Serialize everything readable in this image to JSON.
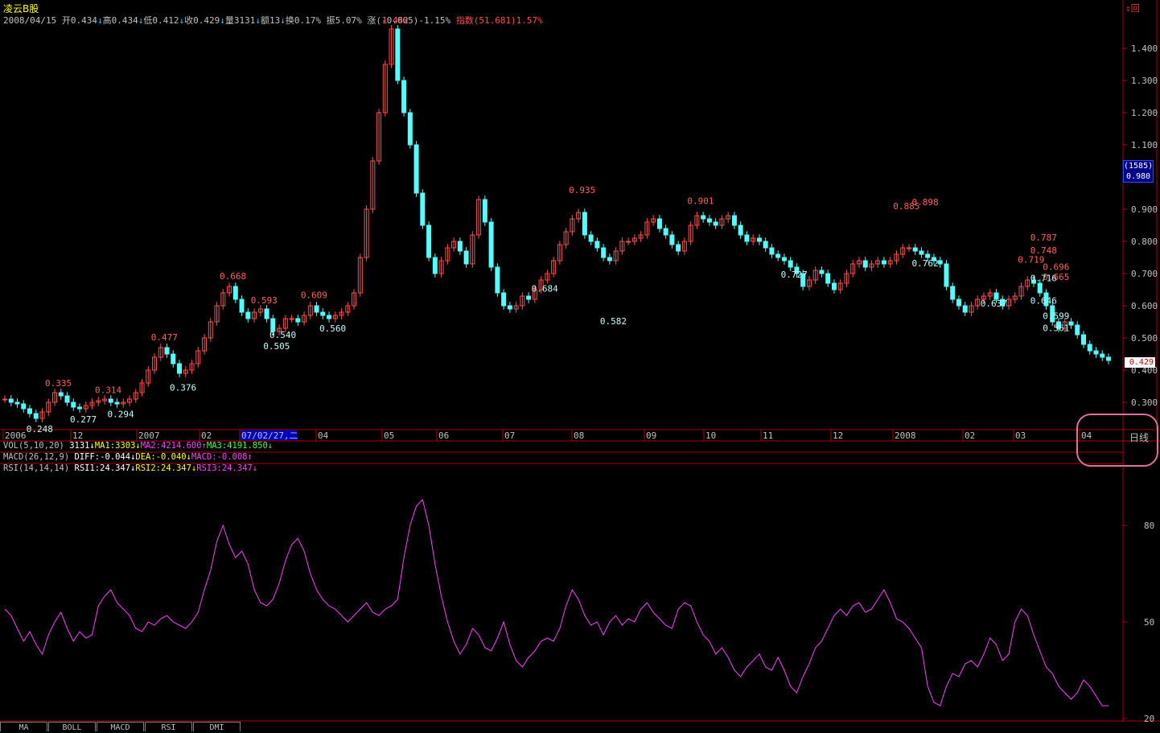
{
  "header": {
    "stock_name": "凌云B股",
    "info": [
      {
        "text": "2008/04/15",
        "color": "#c0c0c0"
      },
      {
        "text": " 开0.434",
        "color": "#c0c0c0"
      },
      {
        "text": "↓",
        "color": "#40c0ff"
      },
      {
        "text": "高0.434",
        "color": "#c0c0c0"
      },
      {
        "text": "↓",
        "color": "#40c0ff"
      },
      {
        "text": "低0.412",
        "color": "#c0c0c0"
      },
      {
        "text": "↓",
        "color": "#40c0ff"
      },
      {
        "text": "收0.429",
        "color": "#c0c0c0"
      },
      {
        "text": "↓",
        "color": "#40c0ff"
      },
      {
        "text": "量3131",
        "color": "#c0c0c0"
      },
      {
        "text": "↓",
        "color": "#40c0ff"
      },
      {
        "text": "额13",
        "color": "#c0c0c0"
      },
      {
        "text": "↓",
        "color": "#40c0ff"
      },
      {
        "text": "换0.17%",
        "color": "#c0c0c0"
      },
      {
        "text": " 振5.07%",
        "color": "#c0c0c0"
      },
      {
        "text": " 涨(-0.005)-1.15%",
        "color": "#c0c0c0"
      },
      {
        "text": " 指数",
        "color": "#ff5050"
      },
      {
        "text": "(51.681)1.57%",
        "color": "#ff5050"
      }
    ],
    "top_right_icon": "⇕回"
  },
  "price_axis": {
    "labels": [
      "1.400",
      "1.300",
      "1.200",
      "1.100",
      "0.900",
      "0.800",
      "0.700",
      "0.600",
      "0.500",
      "0.400",
      "0.300"
    ],
    "values": [
      1.4,
      1.3,
      1.2,
      1.1,
      0.9,
      0.8,
      0.7,
      0.6,
      0.5,
      0.4,
      0.3
    ],
    "cursor_box_line1": "(1585)",
    "cursor_box_line2": "0.980",
    "last_price": "0.429"
  },
  "date_axis": {
    "labels": [
      "2006",
      "12",
      "2007",
      "02",
      "07/02/27,二",
      "04",
      "05",
      "06",
      "07",
      "08",
      "09",
      "10",
      "11",
      "12",
      "2008",
      "02",
      "03",
      "04"
    ],
    "highlight_index": 4
  },
  "period_label": "日线",
  "indicators": {
    "vol": [
      {
        "text": "VOL(5,10,20) ",
        "color": "#c0c0c0"
      },
      {
        "text": "3131",
        "color": "#ffffff"
      },
      {
        "text": "↓",
        "color": "#ffffff"
      },
      {
        "text": "MA1:3303",
        "color": "#ffff00"
      },
      {
        "text": "↓",
        "color": "#ffff00"
      },
      {
        "text": "MA2:4214.600",
        "color": "#ff40ff"
      },
      {
        "text": "↑",
        "color": "#ff40ff"
      },
      {
        "text": "MA3:4191.850",
        "color": "#40ff40"
      },
      {
        "text": "↓",
        "color": "#40ff40"
      }
    ],
    "macd": [
      {
        "text": "MACD(26,12,9) ",
        "color": "#c0c0c0"
      },
      {
        "text": "DIFF:-0.044",
        "color": "#ffffff"
      },
      {
        "text": "↓",
        "color": "#ffffff"
      },
      {
        "text": "DEA:-0.040",
        "color": "#ffff00"
      },
      {
        "text": "↓",
        "color": "#ffff00"
      },
      {
        "text": "MACD:-0.008",
        "color": "#ff40ff"
      },
      {
        "text": "↑",
        "color": "#ff40ff"
      }
    ],
    "rsi": [
      {
        "text": "RSI(14,14,14) ",
        "color": "#c0c0c0"
      },
      {
        "text": "RSI1:24.347",
        "color": "#ffffff"
      },
      {
        "text": "↓",
        "color": "#ffffff"
      },
      {
        "text": "RSI2:24.347",
        "color": "#ffff00"
      },
      {
        "text": "↓",
        "color": "#ffff00"
      },
      {
        "text": "RSI3:24.347",
        "color": "#ff40ff"
      },
      {
        "text": "↓",
        "color": "#ff40ff"
      }
    ]
  },
  "rsi_axis": {
    "labels": [
      "80",
      "50",
      "20"
    ],
    "values": [
      80,
      50,
      20
    ]
  },
  "tabs": [
    "MA",
    "BOLL",
    "MACD",
    "RSI",
    "DMI"
  ],
  "colors": {
    "up": "#ff5050",
    "down": "#54ffff",
    "frame": "#b00000",
    "rsi_line": "#ff40ff"
  },
  "chart_data": {
    "type": "candlestick",
    "price_range": [
      0.22,
      1.5
    ],
    "price_annotations": [
      {
        "label": "0.248",
        "value": 0.248,
        "low": true
      },
      {
        "label": "0.335",
        "value": 0.335,
        "low": false
      },
      {
        "label": "0.277",
        "value": 0.277,
        "low": true
      },
      {
        "label": "0.314",
        "value": 0.314,
        "low": false
      },
      {
        "label": "0.294",
        "value": 0.294,
        "low": true
      },
      {
        "label": "0.477",
        "value": 0.477,
        "low": false
      },
      {
        "label": "0.376",
        "value": 0.376,
        "low": true
      },
      {
        "label": "0.668",
        "value": 0.668,
        "low": false
      },
      {
        "label": "0.593",
        "value": 0.593,
        "low": false
      },
      {
        "label": "0.505",
        "value": 0.505,
        "low": true
      },
      {
        "label": "0.540",
        "value": 0.54,
        "low": true
      },
      {
        "label": "0.609",
        "value": 0.609,
        "low": false
      },
      {
        "label": "0.560",
        "value": 0.56,
        "low": true
      },
      {
        "label": "1.462",
        "value": 1.462,
        "low": false
      },
      {
        "label": "0.684",
        "value": 0.684,
        "low": true
      },
      {
        "label": "0.935",
        "value": 0.935,
        "low": false
      },
      {
        "label": "0.582",
        "value": 0.582,
        "low": true
      },
      {
        "label": "0.901",
        "value": 0.901,
        "low": false
      },
      {
        "label": "0.727",
        "value": 0.727,
        "low": true
      },
      {
        "label": "0.885",
        "value": 0.885,
        "low": false
      },
      {
        "label": "0.762",
        "value": 0.762,
        "low": true
      },
      {
        "label": "0.898",
        "value": 0.898,
        "low": false
      },
      {
        "label": "0.637",
        "value": 0.637,
        "low": true
      },
      {
        "label": "0.719",
        "value": 0.719,
        "low": false
      },
      {
        "label": "0.646",
        "value": 0.646,
        "low": true
      },
      {
        "label": "0.748",
        "value": 0.748,
        "low": false
      },
      {
        "label": "0.716",
        "value": 0.716,
        "low": true
      },
      {
        "label": "0.787",
        "value": 0.787,
        "low": false
      },
      {
        "label": "0.561",
        "value": 0.561,
        "low": true
      },
      {
        "label": "0.665",
        "value": 0.665,
        "low": false
      },
      {
        "label": "0.599",
        "value": 0.599,
        "low": true
      },
      {
        "label": "0.696",
        "value": 0.696,
        "low": false
      }
    ],
    "price_path": [
      0.31,
      0.3,
      0.295,
      0.28,
      0.265,
      0.25,
      0.27,
      0.3,
      0.33,
      0.32,
      0.3,
      0.285,
      0.28,
      0.29,
      0.3,
      0.305,
      0.31,
      0.3,
      0.295,
      0.3,
      0.31,
      0.33,
      0.36,
      0.4,
      0.44,
      0.47,
      0.45,
      0.42,
      0.39,
      0.4,
      0.42,
      0.46,
      0.5,
      0.55,
      0.6,
      0.64,
      0.66,
      0.62,
      0.58,
      0.56,
      0.58,
      0.59,
      0.56,
      0.52,
      0.53,
      0.56,
      0.56,
      0.55,
      0.57,
      0.6,
      0.58,
      0.57,
      0.56,
      0.57,
      0.58,
      0.6,
      0.64,
      0.75,
      0.9,
      1.05,
      1.2,
      1.35,
      1.46,
      1.3,
      1.2,
      1.1,
      0.95,
      0.85,
      0.75,
      0.7,
      0.74,
      0.78,
      0.8,
      0.77,
      0.73,
      0.82,
      0.93,
      0.86,
      0.72,
      0.64,
      0.6,
      0.59,
      0.6,
      0.63,
      0.62,
      0.65,
      0.68,
      0.7,
      0.74,
      0.79,
      0.83,
      0.87,
      0.89,
      0.82,
      0.8,
      0.78,
      0.75,
      0.74,
      0.77,
      0.8,
      0.8,
      0.81,
      0.82,
      0.86,
      0.87,
      0.84,
      0.82,
      0.79,
      0.77,
      0.8,
      0.85,
      0.88,
      0.87,
      0.86,
      0.85,
      0.87,
      0.88,
      0.85,
      0.82,
      0.8,
      0.81,
      0.8,
      0.78,
      0.76,
      0.75,
      0.74,
      0.72,
      0.7,
      0.66,
      0.68,
      0.71,
      0.7,
      0.67,
      0.65,
      0.67,
      0.7,
      0.73,
      0.74,
      0.72,
      0.73,
      0.74,
      0.73,
      0.74,
      0.76,
      0.78,
      0.78,
      0.77,
      0.76,
      0.75,
      0.74,
      0.73,
      0.66,
      0.62,
      0.6,
      0.58,
      0.6,
      0.62,
      0.63,
      0.64,
      0.62,
      0.6,
      0.62,
      0.63,
      0.66,
      0.68,
      0.67,
      0.64,
      0.6,
      0.55,
      0.53,
      0.55,
      0.54,
      0.51,
      0.48,
      0.46,
      0.45,
      0.44,
      0.43
    ],
    "rsi_series": [
      54,
      52,
      48,
      44,
      47,
      43,
      40,
      46,
      50,
      53,
      48,
      44,
      47,
      45,
      46,
      55,
      58,
      60,
      56,
      54,
      52,
      48,
      47,
      50,
      49,
      51,
      52,
      50,
      49,
      48,
      50,
      53,
      60,
      66,
      75,
      80,
      74,
      70,
      72,
      68,
      60,
      56,
      55,
      57,
      62,
      69,
      74,
      76,
      72,
      65,
      60,
      57,
      55,
      54,
      52,
      50,
      52,
      54,
      56,
      53,
      52,
      54,
      55,
      57,
      70,
      80,
      86,
      88,
      80,
      68,
      58,
      50,
      44,
      40,
      43,
      48,
      46,
      42,
      41,
      45,
      50,
      43,
      38,
      36,
      39,
      41,
      44,
      45,
      44,
      48,
      55,
      60,
      57,
      52,
      49,
      50,
      46,
      50,
      52,
      49,
      51,
      50,
      54,
      56,
      53,
      51,
      49,
      48,
      54,
      56,
      55,
      50,
      46,
      44,
      40,
      42,
      39,
      35,
      33,
      36,
      38,
      40,
      36,
      35,
      39,
      35,
      30,
      28,
      33,
      37,
      42,
      44,
      48,
      52,
      54,
      52,
      55,
      56,
      53,
      54,
      57,
      60,
      56,
      51,
      50,
      48,
      45,
      42,
      30,
      25,
      24,
      30,
      34,
      33,
      37,
      38,
      36,
      40,
      45,
      43,
      38,
      40,
      50,
      54,
      52,
      46,
      41,
      36,
      34,
      30,
      28,
      26,
      28,
      32,
      30,
      27,
      24,
      24
    ]
  }
}
